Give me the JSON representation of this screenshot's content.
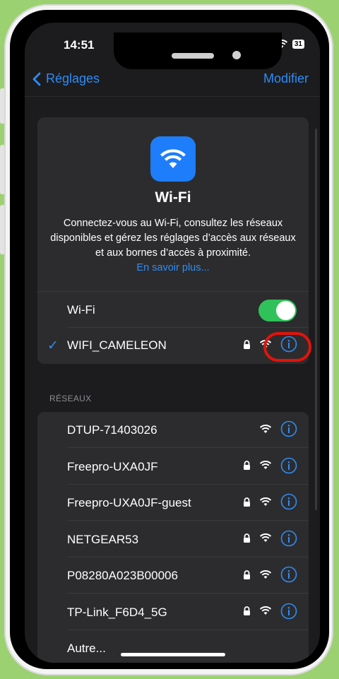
{
  "status": {
    "time": "14:51",
    "battery": "31"
  },
  "nav": {
    "back_label": "Réglages",
    "edit_label": "Modifier"
  },
  "hero": {
    "title": "Wi-Fi",
    "description": "Connectez-vous au Wi-Fi, consultez les réseaux disponibles et gérez les réglages d’accès aux réseaux et aux bornes d’accès à proximité.",
    "link": "En savoir plus..."
  },
  "wifi_toggle": {
    "label": "Wi-Fi",
    "on": true
  },
  "current_network": {
    "name": "WIFI_CAMELEON",
    "locked": true
  },
  "section": {
    "label": "RÉSEAUX"
  },
  "networks": [
    {
      "name": "DTUP-71403026",
      "locked": false
    },
    {
      "name": "Freepro-UXA0JF",
      "locked": true
    },
    {
      "name": "Freepro-UXA0JF-guest",
      "locked": true
    },
    {
      "name": "NETGEAR53",
      "locked": true
    },
    {
      "name": "P08280A023B00006",
      "locked": true
    },
    {
      "name": "TP-Link_F6D4_5G",
      "locked": true
    },
    {
      "name": "Autre...",
      "locked": false
    }
  ],
  "colors": {
    "accent": "#2f8cf5",
    "toggle_on": "#30c15a",
    "highlight": "#e0140c",
    "background": "#9cd171"
  }
}
